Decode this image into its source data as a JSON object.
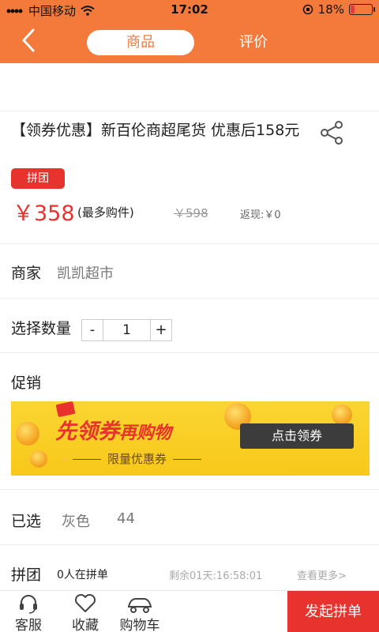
{
  "status_bar": {
    "carrier": "中国移动",
    "time": "17:02",
    "battery": "18%",
    "battery_level": 0.18
  },
  "header": {
    "back_icon": "chevron-left-icon",
    "tabs": [
      {
        "label": "商品",
        "active": true
      },
      {
        "label": "评价",
        "active": false
      }
    ]
  },
  "product": {
    "title": "【领券优惠】新百伦商超尾货 优惠后158元",
    "badge": "拼团",
    "price": "￥358",
    "price_note": "(最多购件)",
    "original_price": "￥598",
    "rebate": "返现:￥0"
  },
  "merchant": {
    "label": "商家",
    "value": "凯凯超市"
  },
  "quantity": {
    "label": "选择数量",
    "minus": "-",
    "value": "1",
    "plus": "+"
  },
  "promotion": {
    "label": "促销",
    "banner_main_a": "先领券",
    "banner_main_b": "再购物",
    "banner_sub": "限量优惠券",
    "banner_button": "点击领券"
  },
  "selected": {
    "label": "已选",
    "color": "灰色",
    "size": "44"
  },
  "group": {
    "label": "拼团",
    "count": "0人在拼单",
    "countdown": "剩余01天:16:58:01",
    "see_more": "查看更多>"
  },
  "bottom_bar": {
    "items": [
      {
        "label": "客服",
        "icon": "headset-icon"
      },
      {
        "label": "收藏",
        "icon": "heart-icon"
      },
      {
        "label": "购物车",
        "icon": "cart-icon"
      }
    ],
    "action": "发起拼单"
  },
  "colors": {
    "brand_orange": "#f47a3c",
    "accent_red": "#e8322e",
    "banner_yellow": "#f8c81a"
  }
}
